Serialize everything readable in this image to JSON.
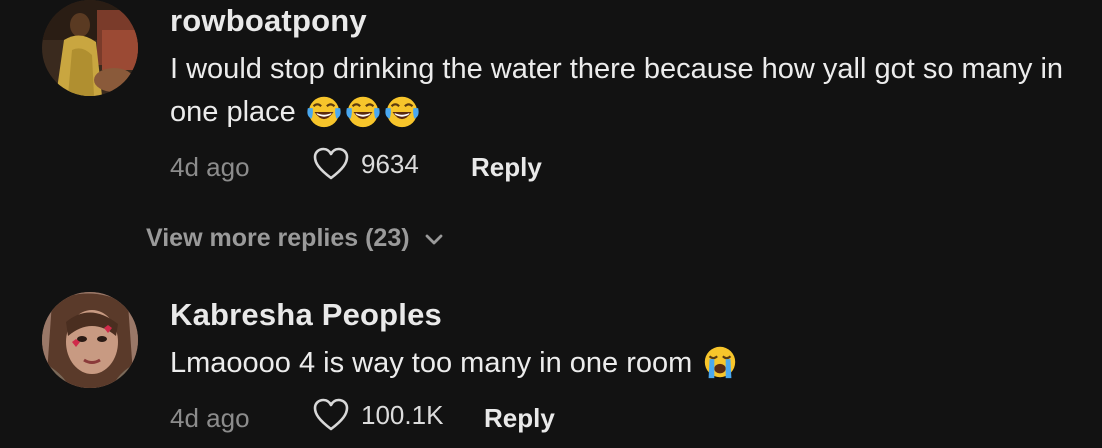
{
  "comments": [
    {
      "username": "rowboatpony",
      "text": "I would stop drinking the water there because how yall got so many in one place",
      "emoji": [
        "face-with-tears-of-joy-icon",
        "face-with-tears-of-joy-icon",
        "face-with-tears-of-joy-icon"
      ],
      "time": "4d ago",
      "likes": "9634",
      "reply_label": "Reply"
    },
    {
      "username": "Kabresha Peoples",
      "text": "Lmaoooo 4 is way too many in one room",
      "emoji": [
        "loudly-crying-face-icon"
      ],
      "time": "4d ago",
      "likes": "100.1K",
      "reply_label": "Reply"
    }
  ],
  "view_more": {
    "label": "View more replies (23)",
    "icon": "chevron-down-icon"
  },
  "colors": {
    "background": "#121212",
    "username": "#e9e9e9",
    "text": "#ececec",
    "muted": "#8c8c8c"
  }
}
